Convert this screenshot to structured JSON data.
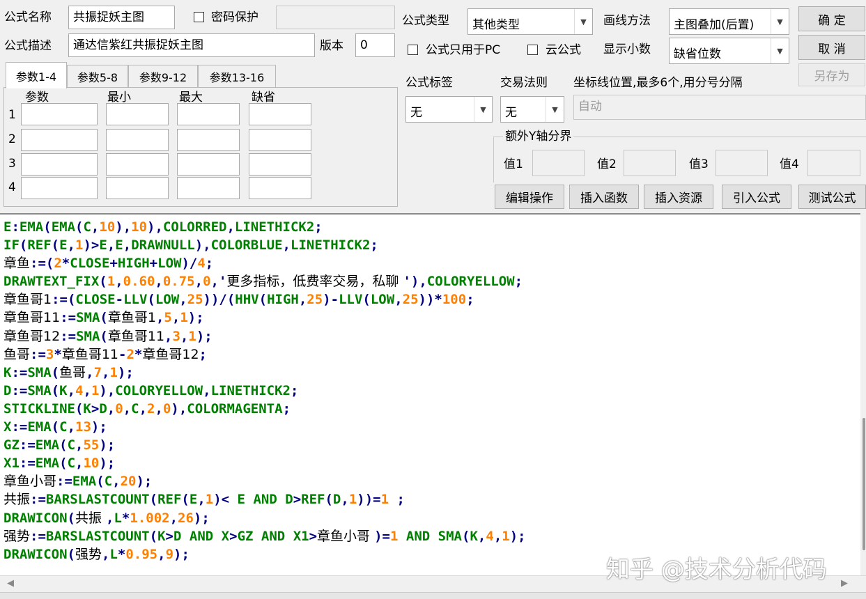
{
  "header": {
    "name_label": "公式名称",
    "name_value": "共振捉妖主图",
    "password_label": "密码保护",
    "desc_label": "公式描述",
    "desc_value": "通达信紫红共振捉妖主图",
    "version_label": "版本",
    "version_value": "0",
    "type_label": "公式类型",
    "type_value": "其他类型",
    "draw_label": "画线方法",
    "draw_value": "主图叠加(后置)",
    "pc_only_label": "公式只用于PC",
    "cloud_label": "云公式",
    "decimals_label": "显示小数",
    "decimals_value": "缺省位数"
  },
  "buttons": {
    "ok": "确 定",
    "cancel": "取 消",
    "save_as": "另存为",
    "edit": "编辑操作",
    "insert_func": "插入函数",
    "insert_res": "插入资源",
    "import": "引入公式",
    "test": "测试公式"
  },
  "tabs": [
    "参数1-4",
    "参数5-8",
    "参数9-12",
    "参数13-16"
  ],
  "params": {
    "columns": [
      "参数",
      "最小",
      "最大",
      "缺省"
    ],
    "rows": [
      "1",
      "2",
      "3",
      "4"
    ]
  },
  "tags": {
    "tag_label": "公式标签",
    "tag_value": "无",
    "rule_label": "交易法则",
    "rule_value": "无",
    "coord_label": "坐标线位置,最多6个,用分号分隔",
    "coord_value": "自动",
    "yaxis_label": "额外Y轴分界",
    "values": [
      "值1",
      "值2",
      "值3",
      "值4"
    ]
  },
  "code_lines": [
    [
      [
        "k",
        "E"
      ],
      [
        "p",
        ":"
      ],
      [
        "k",
        "EMA"
      ],
      [
        "p",
        "("
      ],
      [
        "k",
        "EMA"
      ],
      [
        "p",
        "("
      ],
      [
        "k",
        "C"
      ],
      [
        "p",
        ","
      ],
      [
        "n",
        "10"
      ],
      [
        "p",
        "),"
      ],
      [
        "n",
        "10"
      ],
      [
        "p",
        "),"
      ],
      [
        "k",
        "COLORRED"
      ],
      [
        "p",
        ","
      ],
      [
        "k",
        "LINETHICK2"
      ],
      [
        "p",
        ";"
      ]
    ],
    [
      [
        "k",
        "IF"
      ],
      [
        "p",
        "("
      ],
      [
        "k",
        "REF"
      ],
      [
        "p",
        "("
      ],
      [
        "k",
        "E"
      ],
      [
        "p",
        ","
      ],
      [
        "n",
        "1"
      ],
      [
        "p",
        ")>"
      ],
      [
        "k",
        "E"
      ],
      [
        "p",
        ","
      ],
      [
        "k",
        "E"
      ],
      [
        "p",
        ","
      ],
      [
        "k",
        "DRAWNULL"
      ],
      [
        "p",
        "),"
      ],
      [
        "k",
        "COLORBLUE"
      ],
      [
        "p",
        ","
      ],
      [
        "k",
        "LINETHICK2"
      ],
      [
        "p",
        ";"
      ]
    ],
    [
      [
        "c",
        "章鱼"
      ],
      [
        "p",
        ":=("
      ],
      [
        "n",
        "2"
      ],
      [
        "p",
        "*"
      ],
      [
        "k",
        "CLOSE"
      ],
      [
        "p",
        "+"
      ],
      [
        "k",
        "HIGH"
      ],
      [
        "p",
        "+"
      ],
      [
        "k",
        "LOW"
      ],
      [
        "p",
        ")/"
      ],
      [
        "n",
        "4"
      ],
      [
        "p",
        ";"
      ]
    ],
    [
      [
        "k",
        "DRAWTEXT_FIX"
      ],
      [
        "p",
        "("
      ],
      [
        "n",
        "1"
      ],
      [
        "p",
        ","
      ],
      [
        "n",
        "0.60"
      ],
      [
        "p",
        ","
      ],
      [
        "n",
        "0.75"
      ],
      [
        "p",
        ","
      ],
      [
        "n",
        "0"
      ],
      [
        "p",
        ",'"
      ],
      [
        "s",
        "更多指标，低费率交易，私聊 "
      ],
      [
        "p",
        "'),"
      ],
      [
        "k",
        "COLORYELLOW"
      ],
      [
        "p",
        ";"
      ]
    ],
    [
      [
        "c",
        "章鱼哥1"
      ],
      [
        "p",
        ":=("
      ],
      [
        "k",
        "CLOSE"
      ],
      [
        "p",
        "-"
      ],
      [
        "k",
        "LLV"
      ],
      [
        "p",
        "("
      ],
      [
        "k",
        "LOW"
      ],
      [
        "p",
        ","
      ],
      [
        "n",
        "25"
      ],
      [
        "p",
        "))/("
      ],
      [
        "k",
        "HHV"
      ],
      [
        "p",
        "("
      ],
      [
        "k",
        "HIGH"
      ],
      [
        "p",
        ","
      ],
      [
        "n",
        "25"
      ],
      [
        "p",
        ")-"
      ],
      [
        "k",
        "LLV"
      ],
      [
        "p",
        "("
      ],
      [
        "k",
        "LOW"
      ],
      [
        "p",
        ","
      ],
      [
        "n",
        "25"
      ],
      [
        "p",
        "))*"
      ],
      [
        "n",
        "100"
      ],
      [
        "p",
        ";"
      ]
    ],
    [
      [
        "c",
        "章鱼哥11"
      ],
      [
        "p",
        ":="
      ],
      [
        "k",
        "SMA"
      ],
      [
        "p",
        "("
      ],
      [
        "c",
        "章鱼哥1"
      ],
      [
        "p",
        ","
      ],
      [
        "n",
        "5"
      ],
      [
        "p",
        ","
      ],
      [
        "n",
        "1"
      ],
      [
        "p",
        ");"
      ]
    ],
    [
      [
        "c",
        "章鱼哥12"
      ],
      [
        "p",
        ":="
      ],
      [
        "k",
        "SMA"
      ],
      [
        "p",
        "("
      ],
      [
        "c",
        "章鱼哥11"
      ],
      [
        "p",
        ","
      ],
      [
        "n",
        "3"
      ],
      [
        "p",
        ","
      ],
      [
        "n",
        "1"
      ],
      [
        "p",
        ");"
      ]
    ],
    [
      [
        "c",
        "鱼哥"
      ],
      [
        "p",
        ":="
      ],
      [
        "n",
        "3"
      ],
      [
        "p",
        "*"
      ],
      [
        "c",
        "章鱼哥11"
      ],
      [
        "p",
        "-"
      ],
      [
        "n",
        "2"
      ],
      [
        "p",
        "*"
      ],
      [
        "c",
        "章鱼哥12"
      ],
      [
        "p",
        ";"
      ]
    ],
    [
      [
        "k",
        "K"
      ],
      [
        "p",
        ":="
      ],
      [
        "k",
        "SMA"
      ],
      [
        "p",
        "("
      ],
      [
        "c",
        "鱼哥"
      ],
      [
        "p",
        ","
      ],
      [
        "n",
        "7"
      ],
      [
        "p",
        ","
      ],
      [
        "n",
        "1"
      ],
      [
        "p",
        ");"
      ]
    ],
    [
      [
        "k",
        "D"
      ],
      [
        "p",
        ":="
      ],
      [
        "k",
        "SMA"
      ],
      [
        "p",
        "("
      ],
      [
        "k",
        "K"
      ],
      [
        "p",
        ","
      ],
      [
        "n",
        "4"
      ],
      [
        "p",
        ","
      ],
      [
        "n",
        "1"
      ],
      [
        "p",
        "),"
      ],
      [
        "k",
        "COLORYELLOW"
      ],
      [
        "p",
        ","
      ],
      [
        "k",
        "LINETHICK2"
      ],
      [
        "p",
        ";"
      ]
    ],
    [
      [
        "k",
        "STICKLINE"
      ],
      [
        "p",
        "("
      ],
      [
        "k",
        "K"
      ],
      [
        "p",
        ">"
      ],
      [
        "k",
        "D"
      ],
      [
        "p",
        ","
      ],
      [
        "n",
        "0"
      ],
      [
        "p",
        ","
      ],
      [
        "k",
        "C"
      ],
      [
        "p",
        ","
      ],
      [
        "n",
        "2"
      ],
      [
        "p",
        ","
      ],
      [
        "n",
        "0"
      ],
      [
        "p",
        "),"
      ],
      [
        "k",
        "COLORMAGENTA"
      ],
      [
        "p",
        ";"
      ]
    ],
    [
      [
        "k",
        "X"
      ],
      [
        "p",
        ":="
      ],
      [
        "k",
        "EMA"
      ],
      [
        "p",
        "("
      ],
      [
        "k",
        "C"
      ],
      [
        "p",
        ","
      ],
      [
        "n",
        "13"
      ],
      [
        "p",
        ");"
      ]
    ],
    [
      [
        "k",
        "GZ"
      ],
      [
        "p",
        ":="
      ],
      [
        "k",
        "EMA"
      ],
      [
        "p",
        "("
      ],
      [
        "k",
        "C"
      ],
      [
        "p",
        ","
      ],
      [
        "n",
        "55"
      ],
      [
        "p",
        ");"
      ]
    ],
    [
      [
        "k",
        "X1"
      ],
      [
        "p",
        ":="
      ],
      [
        "k",
        "EMA"
      ],
      [
        "p",
        "("
      ],
      [
        "k",
        "C"
      ],
      [
        "p",
        ","
      ],
      [
        "n",
        "10"
      ],
      [
        "p",
        ");"
      ]
    ],
    [
      [
        "c",
        "章鱼小哥"
      ],
      [
        "p",
        ":="
      ],
      [
        "k",
        "EMA"
      ],
      [
        "p",
        "("
      ],
      [
        "k",
        "C"
      ],
      [
        "p",
        ","
      ],
      [
        "n",
        "20"
      ],
      [
        "p",
        ");"
      ]
    ],
    [
      [
        "c",
        "共振"
      ],
      [
        "p",
        ":="
      ],
      [
        "k",
        "BARSLASTCOUNT"
      ],
      [
        "p",
        "("
      ],
      [
        "k",
        "REF"
      ],
      [
        "p",
        "("
      ],
      [
        "k",
        "E"
      ],
      [
        "p",
        ","
      ],
      [
        "n",
        "1"
      ],
      [
        "p",
        ")< "
      ],
      [
        "k",
        "E"
      ],
      [
        "p",
        " "
      ],
      [
        "k",
        "AND"
      ],
      [
        "p",
        " "
      ],
      [
        "k",
        "D"
      ],
      [
        "p",
        ">"
      ],
      [
        "k",
        "REF"
      ],
      [
        "p",
        "("
      ],
      [
        "k",
        "D"
      ],
      [
        "p",
        ","
      ],
      [
        "n",
        "1"
      ],
      [
        "p",
        "))="
      ],
      [
        "n",
        "1"
      ],
      [
        "p",
        " ;"
      ]
    ],
    [
      [
        "k",
        "DRAWICON"
      ],
      [
        "p",
        "("
      ],
      [
        "c",
        "共振 "
      ],
      [
        "p",
        ","
      ],
      [
        "k",
        "L"
      ],
      [
        "p",
        "*"
      ],
      [
        "n",
        "1.002"
      ],
      [
        "p",
        ","
      ],
      [
        "n",
        "26"
      ],
      [
        "p",
        ");"
      ]
    ],
    [
      [
        "c",
        "强势"
      ],
      [
        "p",
        ":="
      ],
      [
        "k",
        "BARSLASTCOUNT"
      ],
      [
        "p",
        "("
      ],
      [
        "k",
        "K"
      ],
      [
        "p",
        ">"
      ],
      [
        "k",
        "D"
      ],
      [
        "p",
        " "
      ],
      [
        "k",
        "AND"
      ],
      [
        "p",
        " "
      ],
      [
        "k",
        "X"
      ],
      [
        "p",
        ">"
      ],
      [
        "k",
        "GZ"
      ],
      [
        "p",
        " "
      ],
      [
        "k",
        "AND"
      ],
      [
        "p",
        " "
      ],
      [
        "k",
        "X1"
      ],
      [
        "p",
        ">"
      ],
      [
        "c",
        "章鱼小哥 "
      ],
      [
        "p",
        ")="
      ],
      [
        "n",
        "1"
      ],
      [
        "p",
        " "
      ],
      [
        "k",
        "AND"
      ],
      [
        "p",
        " "
      ],
      [
        "k",
        "SMA"
      ],
      [
        "p",
        "("
      ],
      [
        "k",
        "K"
      ],
      [
        "p",
        ","
      ],
      [
        "n",
        "4"
      ],
      [
        "p",
        ","
      ],
      [
        "n",
        "1"
      ],
      [
        "p",
        ");"
      ]
    ],
    [
      [
        "k",
        "DRAWICON"
      ],
      [
        "p",
        "("
      ],
      [
        "c",
        "强势"
      ],
      [
        "p",
        ","
      ],
      [
        "k",
        "L"
      ],
      [
        "p",
        "*"
      ],
      [
        "n",
        "0.95"
      ],
      [
        "p",
        ","
      ],
      [
        "n",
        "9"
      ],
      [
        "p",
        ");"
      ]
    ]
  ],
  "watermark": "知乎 @技术分析代码"
}
